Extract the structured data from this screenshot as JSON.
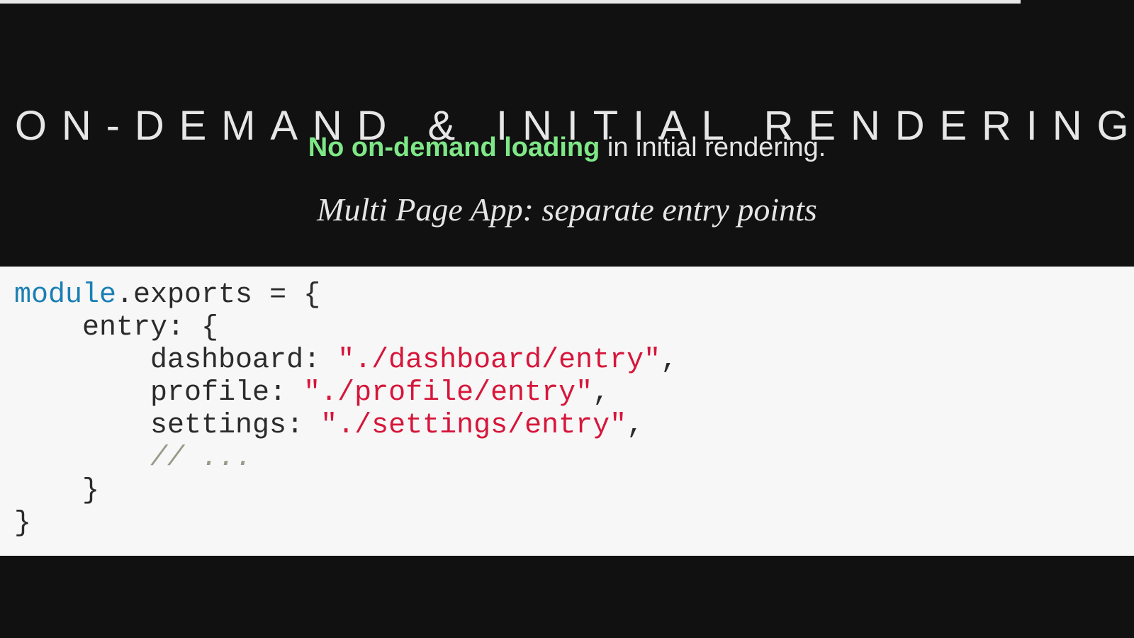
{
  "progress": {
    "fraction": 0.9
  },
  "slide": {
    "title": "ON-DEMAND & INITIAL RENDERING",
    "subtitle_highlight": "No on-demand loading",
    "subtitle_rest": " in initial rendering.",
    "caption": "Multi Page App: separate entry points"
  },
  "code": {
    "line1_kw": "module",
    "line1_rest": ".exports = {",
    "line2": "    entry: {",
    "line3_key": "        dashboard: ",
    "line3_str": "\"./dashboard/entry\"",
    "line3_end": ",",
    "line4_key": "        profile: ",
    "line4_str": "\"./profile/entry\"",
    "line4_end": ",",
    "line5_key": "        settings: ",
    "line5_str": "\"./settings/entry\"",
    "line5_end": ",",
    "line6_comment": "// ...",
    "line7": "    }",
    "line8": "}"
  },
  "colors": {
    "background": "#111111",
    "highlight": "#7ee787",
    "code_keyword": "#1b7fb5",
    "code_string": "#d6163a",
    "code_comment": "#9a9a8a",
    "code_background": "#f7f7f7"
  }
}
